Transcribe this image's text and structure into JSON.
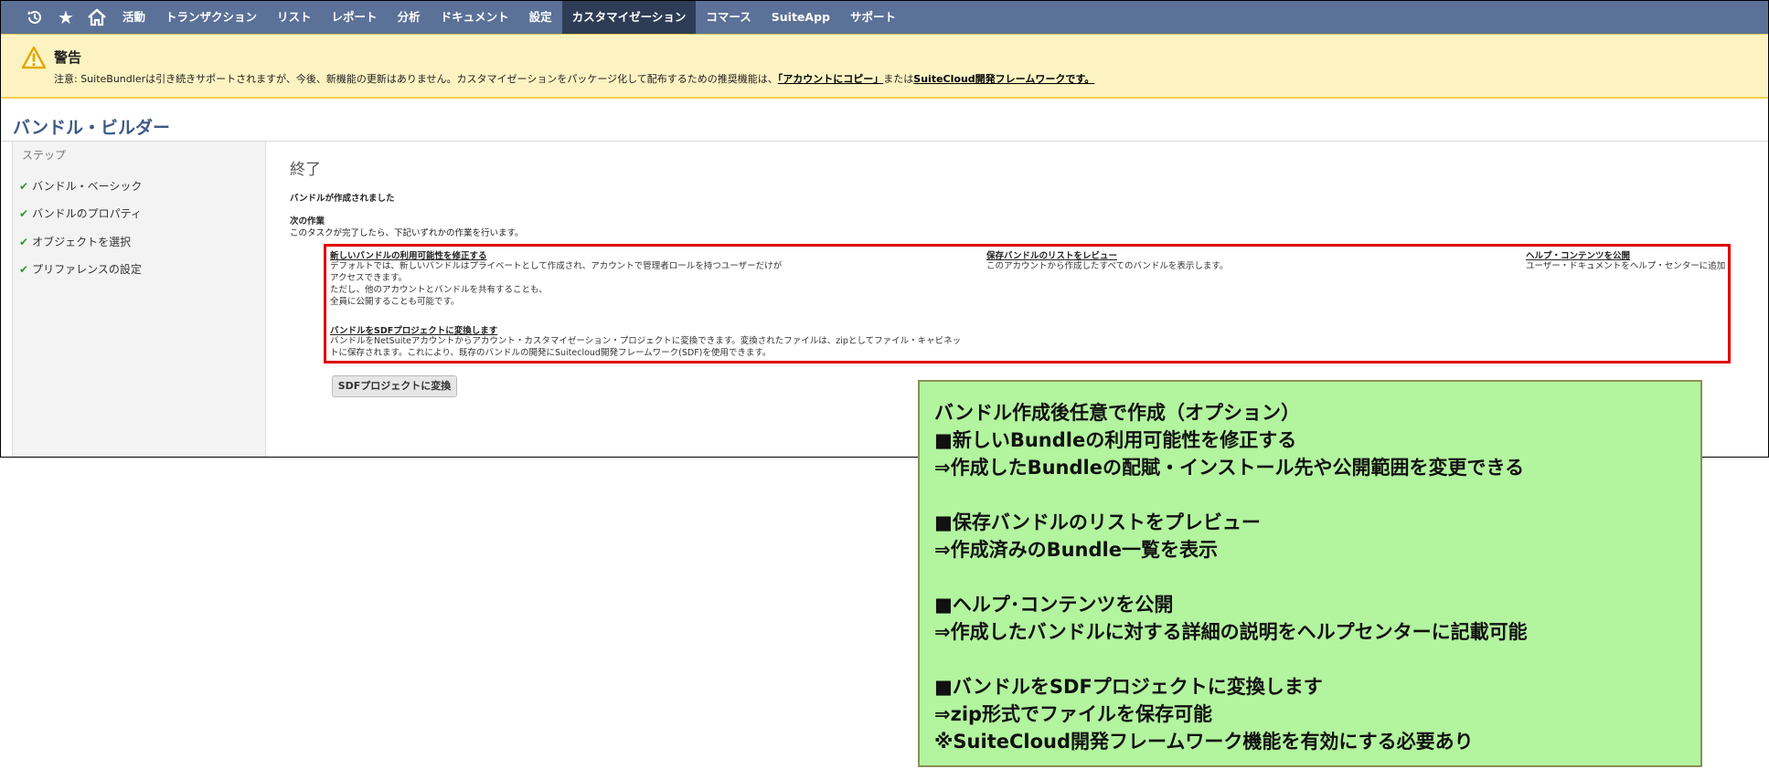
{
  "nav": {
    "icons": [
      "recent-icon",
      "star-icon",
      "home-icon"
    ],
    "items": [
      "活動",
      "トランザクション",
      "リスト",
      "レポート",
      "分析",
      "ドキュメント",
      "設定",
      "カスタマイゼーション",
      "コマース",
      "SuiteApp",
      "サポート"
    ],
    "active": "カスタマイゼーション"
  },
  "warning": {
    "title": "警告",
    "text": "注意: SuiteBundlerは引き続きサポートされますが、今後、新機能の更新はありません。カスタマイゼーションをパッケージ化して配布するための推奨機能は、",
    "link1": "「アカウントにコピー」",
    "mid": "または",
    "link2": "SuiteCloud開発フレームワークです。"
  },
  "page": {
    "title": "バンドル・ビルダー"
  },
  "steps": {
    "heading": "ステップ",
    "items": [
      "バンドル・ベーシック",
      "バンドルのプロパティ",
      "オブジェクトを選択",
      "プリファレンスの設定"
    ]
  },
  "main": {
    "finish": "終了",
    "created": "バンドルが作成されました",
    "next_heading": "次の作業",
    "next_text": "このタスクが完了したら、下記いずれかの作業を行います。",
    "links": {
      "modify": {
        "title": "新しいバンドルの利用可能性を修正する",
        "lines": [
          "デフォルトでは、新しいバンドルはプライベートとして作成され、アカウントで管理者ロールを持つユーザーだけが",
          "アクセスできます。",
          "ただし、他のアカウントとバンドルを共有することも、",
          "全員に公開することも可能です。"
        ]
      },
      "review": {
        "title": "保存バンドルのリストをレビュー",
        "text": "このアカウントから作成したすべてのバンドルを表示します。"
      },
      "help": {
        "title": "ヘルプ・コンテンツを公開",
        "text": "ユーザー・ドキュメントをヘルプ・センターに追加"
      },
      "sdf": {
        "title": "バンドルをSDFプロジェクトに変換します",
        "lines": [
          "バンドルをNetSuiteアカウントからアカウント・カスタマイゼーション・プロジェクトに変換できます。変換されたファイルは、zipとしてファイル・キャビネッ",
          "トに保存されます。これにより、既存のバンドルの開発にSuitecloud開発フレームワーク(SDF)を使用できます。"
        ]
      }
    },
    "convert_button": "SDFプロジェクトに変換"
  },
  "annotation": {
    "lines": [
      "バンドル作成後任意で作成（オプション）",
      "■新しいBundleの利用可能性を修正する",
      "⇒作成したBundleの配賦・インストール先や公開範囲を変更できる",
      "■保存バンドルのリストをプレビュー",
      "⇒作成済みのBundle一覧を表示",
      "■ヘルプ･コンテンツを公開",
      "⇒作成したバンドルに対する詳細の説明をヘルプセンターに記載可能",
      "■バンドルをSDFプロジェクトに変換します",
      "⇒zip形式でファイルを保存可能",
      "※SuiteCloud開発フレームワーク機能を有効にする必要あり"
    ]
  },
  "colors": {
    "nav_bg": "#5b7198",
    "nav_active": "#2e3d55",
    "warning_bg": "#fdf3c2",
    "title": "#3d5a87",
    "highlight_border": "#e00000",
    "annotation_bg": "#b3f49f",
    "check": "#2e9a2e"
  }
}
